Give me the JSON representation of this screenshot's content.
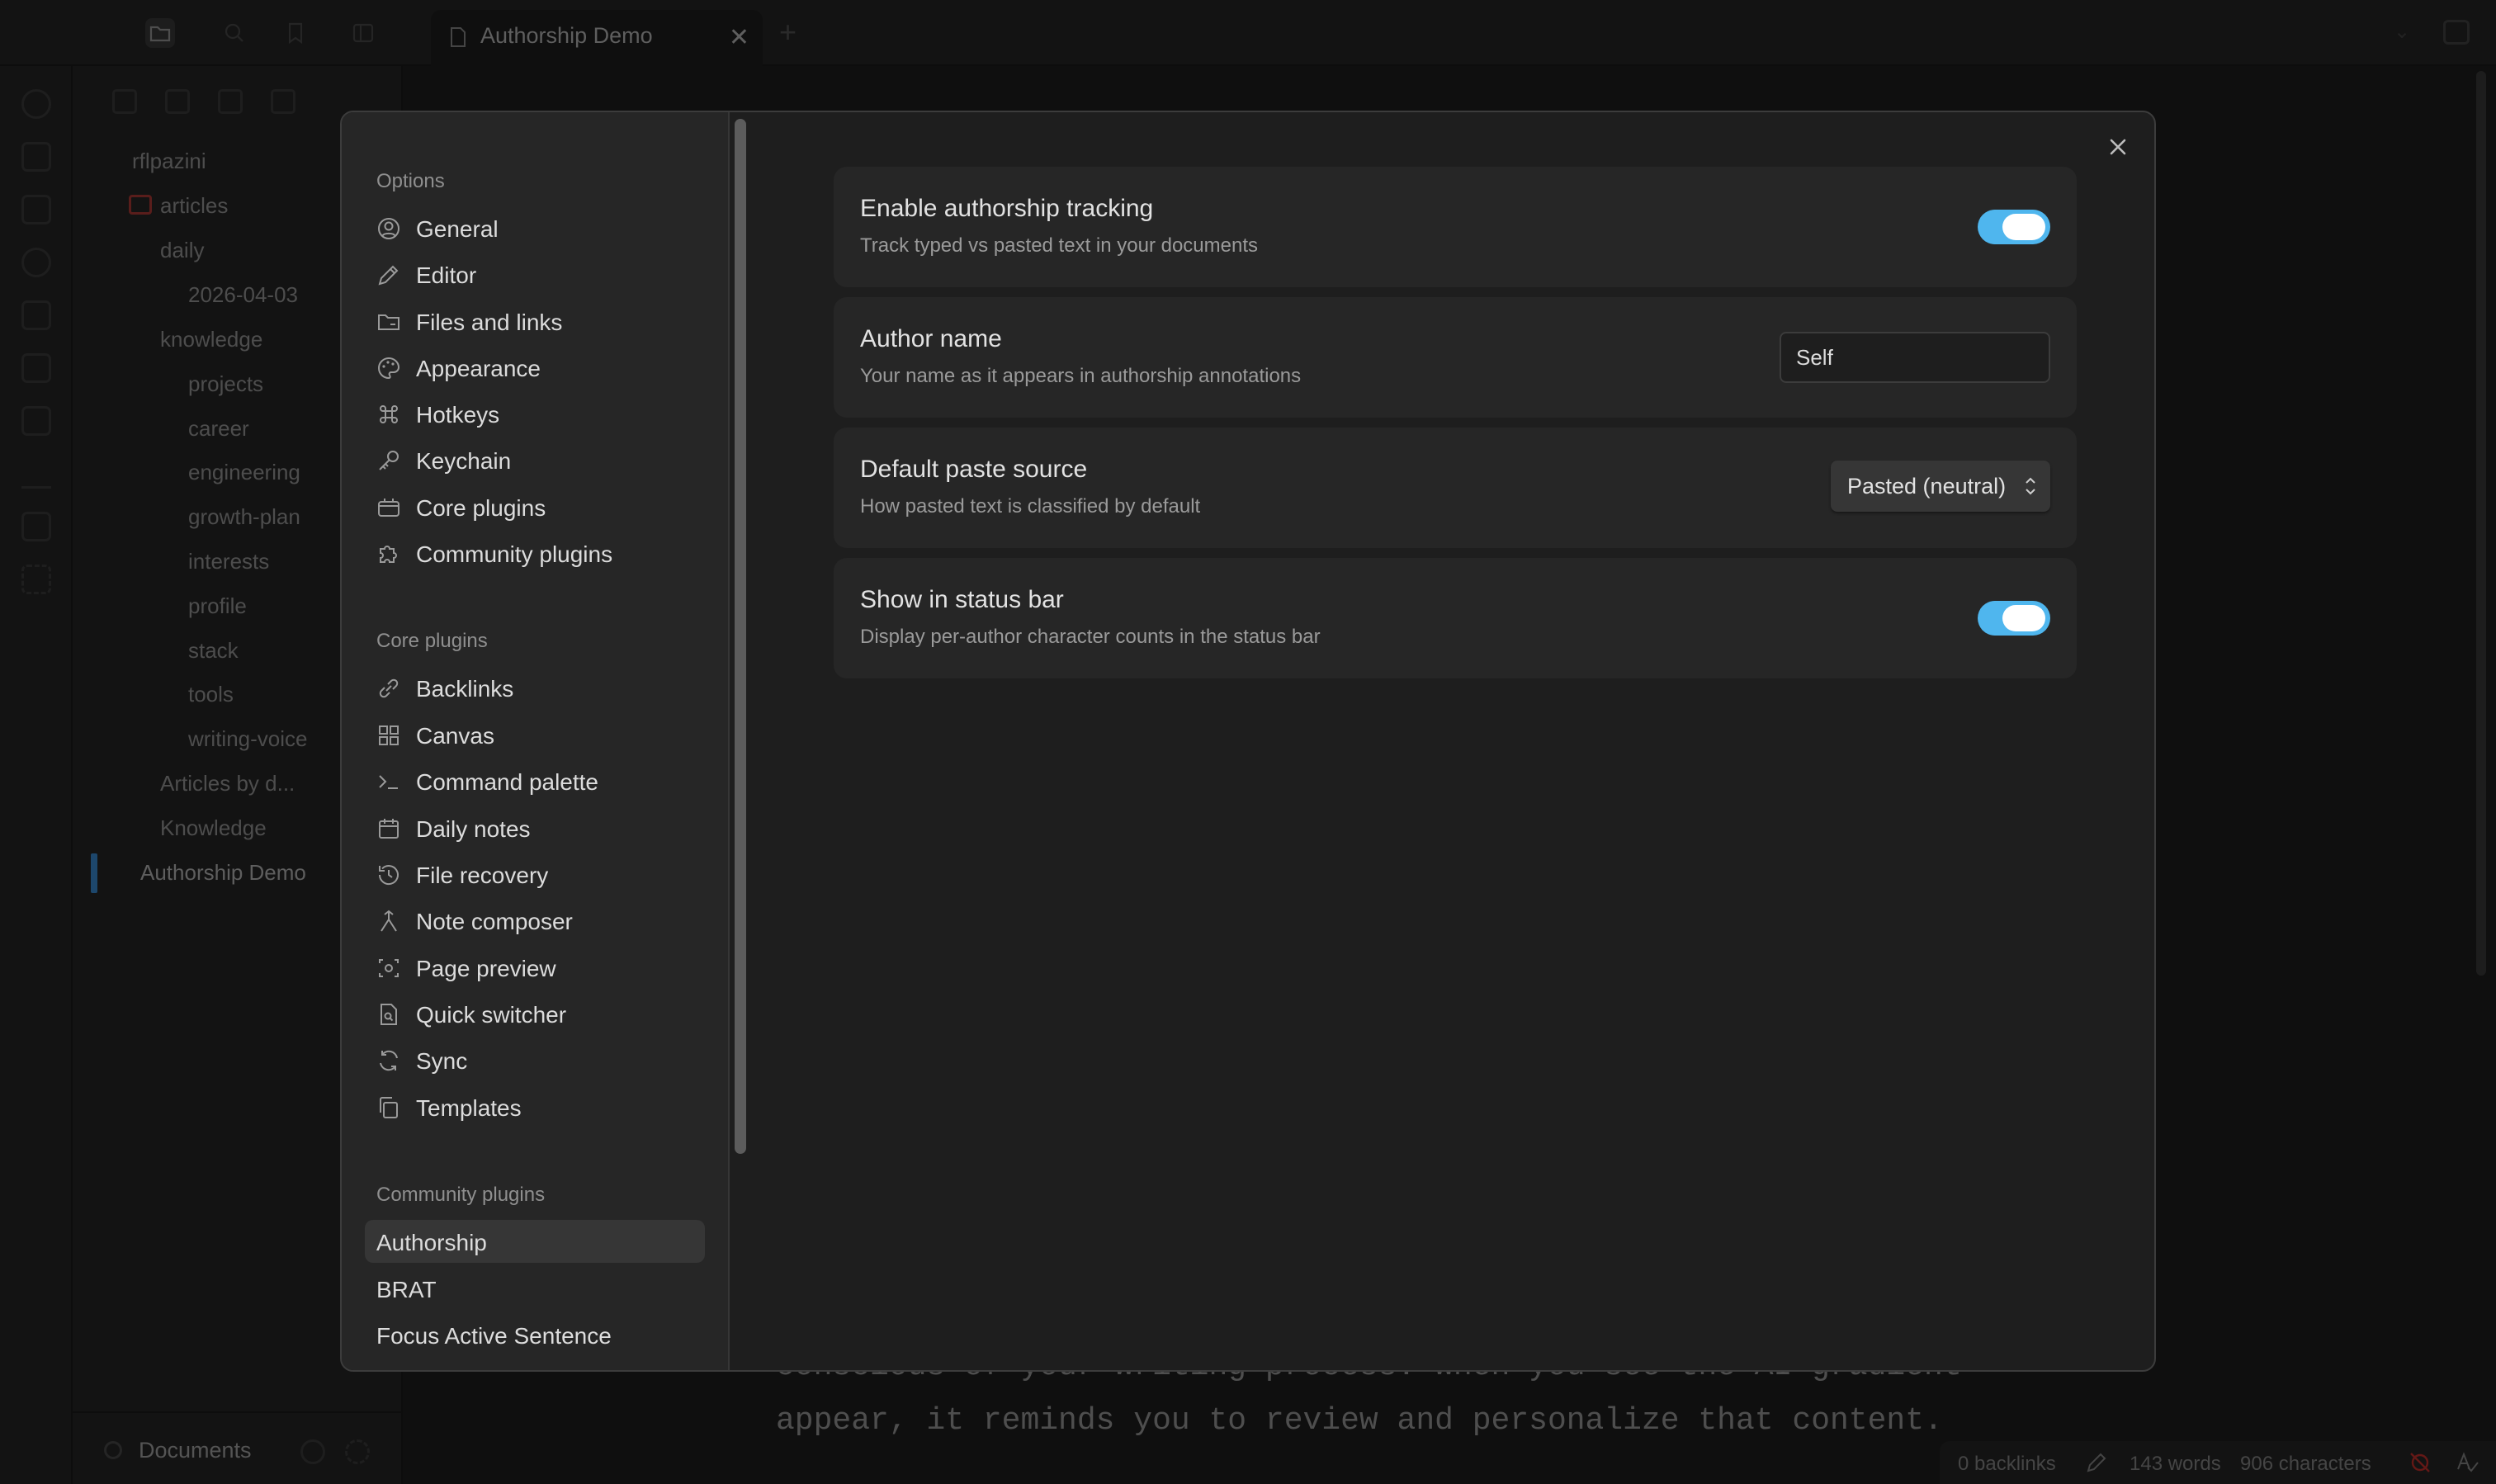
{
  "titlebar": {
    "tab_title": "Authorship Demo"
  },
  "filetree": {
    "vault_name": "rflpazini",
    "items": [
      {
        "label": "articles"
      },
      {
        "label": "daily"
      },
      {
        "label": "2026-04-03"
      },
      {
        "label": "knowledge"
      },
      {
        "label": "projects"
      },
      {
        "label": "career"
      },
      {
        "label": "engineering"
      },
      {
        "label": "growth-plan"
      },
      {
        "label": "interests"
      },
      {
        "label": "profile"
      },
      {
        "label": "stack"
      },
      {
        "label": "tools"
      },
      {
        "label": "writing-voice"
      },
      {
        "label": "Articles by d..."
      },
      {
        "label": "Knowledge"
      },
      {
        "label": "Authorship Demo"
      }
    ],
    "bottom_label": "Documents"
  },
  "editor": {
    "line1": "conscious of your writing process. When you see the AI gradient",
    "line2": "appear, it reminds you to review and personalize that content."
  },
  "statusbar": {
    "backlinks": "0 backlinks",
    "words": "143 words",
    "characters": "906 characters"
  },
  "settings_sidebar": {
    "options_header": "Options",
    "options": [
      {
        "label": "General",
        "icon": "user-circle-icon"
      },
      {
        "label": "Editor",
        "icon": "pencil-icon"
      },
      {
        "label": "Files and links",
        "icon": "folder-link-icon"
      },
      {
        "label": "Appearance",
        "icon": "palette-icon"
      },
      {
        "label": "Hotkeys",
        "icon": "command-icon"
      },
      {
        "label": "Keychain",
        "icon": "key-icon"
      },
      {
        "label": "Core plugins",
        "icon": "plug-box-icon"
      },
      {
        "label": "Community plugins",
        "icon": "puzzle-icon"
      }
    ],
    "core_header": "Core plugins",
    "core": [
      {
        "label": "Backlinks",
        "icon": "link-icon"
      },
      {
        "label": "Canvas",
        "icon": "grid-icon"
      },
      {
        "label": "Command palette",
        "icon": "terminal-icon"
      },
      {
        "label": "Daily notes",
        "icon": "calendar-icon"
      },
      {
        "label": "File recovery",
        "icon": "history-icon"
      },
      {
        "label": "Note composer",
        "icon": "merge-icon"
      },
      {
        "label": "Page preview",
        "icon": "eye-scan-icon"
      },
      {
        "label": "Quick switcher",
        "icon": "file-search-icon"
      },
      {
        "label": "Sync",
        "icon": "sync-icon"
      },
      {
        "label": "Templates",
        "icon": "copy-icon"
      }
    ],
    "community_header": "Community plugins",
    "community": [
      {
        "label": "Authorship"
      },
      {
        "label": "BRAT"
      },
      {
        "label": "Focus Active Sentence"
      }
    ]
  },
  "settings": {
    "tracking": {
      "name": "Enable authorship tracking",
      "desc": "Track typed vs pasted text in your documents",
      "enabled": true
    },
    "author": {
      "name": "Author name",
      "desc": "Your name as it appears in authorship annotations",
      "value": "Self"
    },
    "paste_source": {
      "name": "Default paste source",
      "desc": "How pasted text is classified by default",
      "value": "Pasted (neutral)"
    },
    "status_bar": {
      "name": "Show in status bar",
      "desc": "Display per-author character counts in the status bar",
      "enabled": true
    }
  },
  "colors": {
    "accent_toggle": "#4fb6ee",
    "active_file_bar": "#3b8ed8",
    "articles_icon": "#c9302c"
  }
}
